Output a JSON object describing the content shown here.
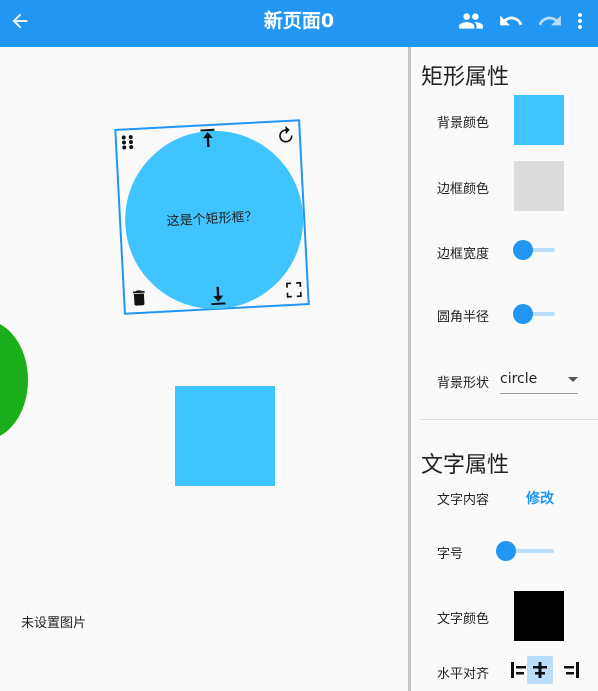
{
  "appbar": {
    "title": "新页面0",
    "back_icon": "arrow-back-icon",
    "actions": [
      "people-icon",
      "undo-icon",
      "redo-icon",
      "more-vert-icon"
    ],
    "color": "#2196f3"
  },
  "canvas": {
    "selected_box_text": "这是个矩形框？",
    "no_image_text": "未设置图片",
    "shape_color": "#40c4ff",
    "green_blob_color": "#1aaf1a"
  },
  "panel": {
    "rect_section": {
      "title": "矩形属性",
      "bg_color_label": "背景颜色",
      "bg_color_value": "#40c4ff",
      "border_color_label": "边框颜色",
      "border_color_value": "#dcdcdc",
      "border_width_label": "边框宽度",
      "border_width_value": 0,
      "radius_label": "圆角半径",
      "radius_value": 0,
      "shape_label": "背景形状",
      "shape_value": "circle"
    },
    "text_section": {
      "title": "文字属性",
      "content_label": "文字内容",
      "modify_label": "修改",
      "size_label": "字号",
      "size_value": 0,
      "text_color_label": "文字颜色",
      "text_color_value": "#000000",
      "halign_label": "水平对齐",
      "halign_options": [
        "align-left-icon",
        "align-center-icon",
        "align-right-icon"
      ],
      "halign_selected": "align-center-icon"
    }
  }
}
